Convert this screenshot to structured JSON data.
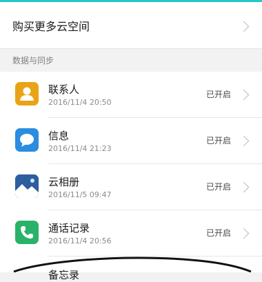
{
  "buy_storage": {
    "label": "购买更多云空间"
  },
  "section": {
    "title": "数据与同步"
  },
  "items": [
    {
      "name": "联系人",
      "time": "2016/11/4 20:50",
      "status": "已开启",
      "icon": "contacts-icon",
      "color": "#e8a317"
    },
    {
      "name": "信息",
      "time": "2016/11/4 21:23",
      "status": "已开启",
      "icon": "messages-icon",
      "color": "#2a8de0"
    },
    {
      "name": "云相册",
      "time": "2016/11/5 09:47",
      "status": "已开启",
      "icon": "gallery-icon",
      "color": "#2d5e9e"
    },
    {
      "name": "通话记录",
      "time": "2016/11/4 20:56",
      "status": "已开启",
      "icon": "call-log-icon",
      "color": "#29b36a"
    }
  ],
  "partial_item": {
    "name": "备忘录"
  },
  "colors": {
    "accent": "#26c6c9"
  }
}
